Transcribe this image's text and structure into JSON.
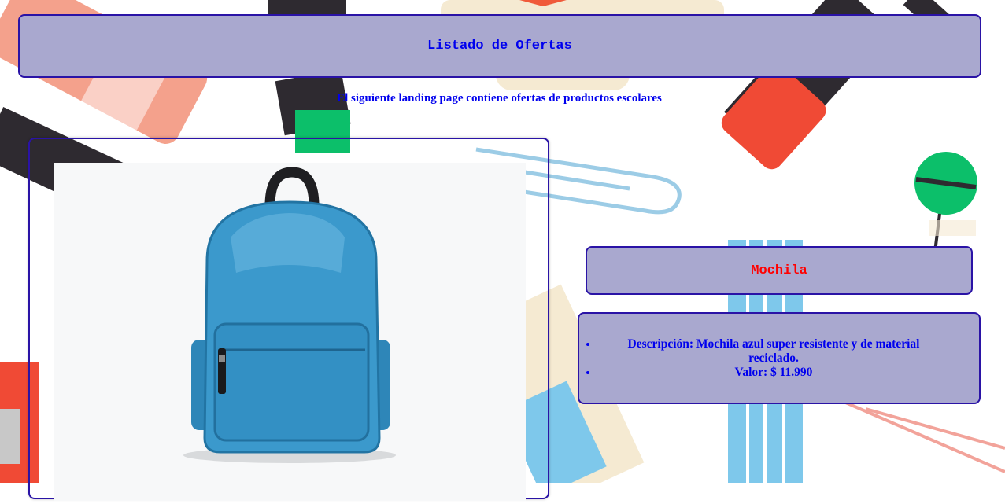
{
  "header": {
    "title": "Listado de Ofertas"
  },
  "subtitle": "El siguiente landing page contiene ofertas de productos escolares",
  "product": {
    "image_icon": "backpack-photo",
    "name": "Mochila",
    "details": [
      {
        "text": "Descripción: Mochila azul super resistente y de material reciclado."
      },
      {
        "text": "Valor: $ 11.990"
      }
    ]
  },
  "colors": {
    "box_background": "#a9a8cf",
    "box_border": "#2a13a6",
    "title_text": "#0000ee",
    "product_name_text": "#ff0000"
  }
}
